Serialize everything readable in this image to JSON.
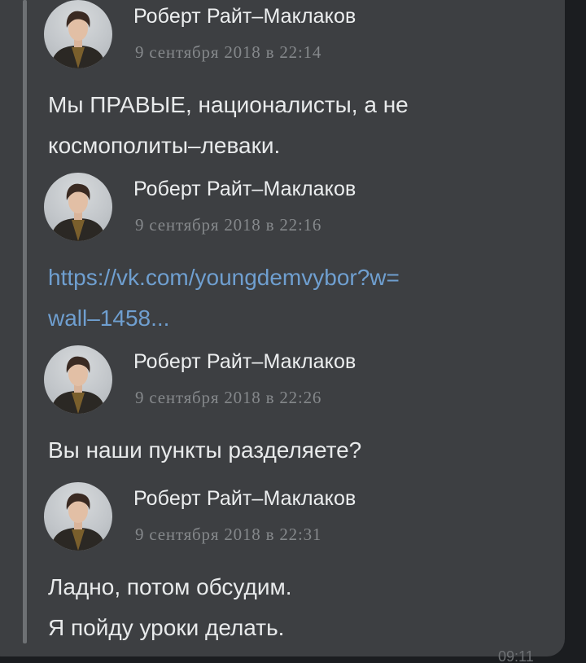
{
  "messages": [
    {
      "author": "Роберт Райт–Маклаков",
      "date": "9 сентября 2018 в 22:14",
      "text": "Мы ПРАВЫЕ, националисты, а не\nкосмополиты–леваки."
    },
    {
      "author": "Роберт Райт–Маклаков",
      "date": "9 сентября 2018 в 22:16",
      "link": "https://vk.com/youngdemvybor?w=\nwall–1458..."
    },
    {
      "author": "Роберт Райт–Маклаков",
      "date": "9 сентября 2018 в 22:26",
      "text": "Вы наши пункты разделяете?"
    },
    {
      "author": "Роберт Райт–Маклаков",
      "date": "9 сентября 2018 в 22:31",
      "text": "Ладно, потом обсудим.\nЯ пойду уроки делать."
    }
  ],
  "message_time": "09:11",
  "colors": {
    "bubble": "#3d3f42",
    "link": "#6f9fd0",
    "date": "#85888b",
    "text": "#e8eaeb"
  },
  "icons": [
    "author-avatar"
  ]
}
